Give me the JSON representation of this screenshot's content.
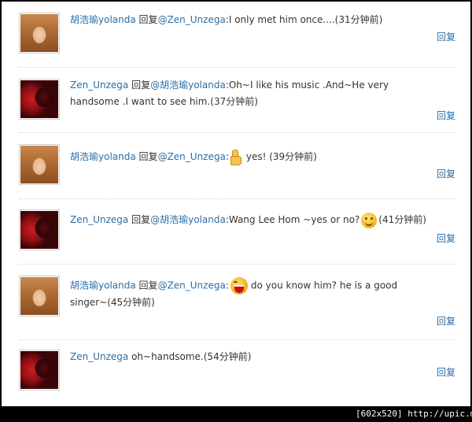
{
  "reply_label": "回复",
  "reply_verb": "回复",
  "footer_text": "[602x520] http://upic.me/",
  "colors": {
    "link": "#2a6ea6",
    "text": "#333333",
    "separator": "#cfd8e3"
  },
  "comments": [
    {
      "user": "胡浩瑜yolanda",
      "mention": "@Zen_Unzega",
      "text": "I only met him once....",
      "time": "(31分钟前)",
      "avatar": "yolanda-avatar"
    },
    {
      "user": "Zen_Unzega",
      "mention": "@胡浩瑜yolanda",
      "text": "Oh~I like his music .And~He very handsome .I want to see him.",
      "time": "(37分钟前)",
      "avatar": "zen-avatar"
    },
    {
      "user": "胡浩瑜yolanda",
      "mention": "@Zen_Unzega",
      "text": "yes!",
      "time": "(39分钟前)",
      "emoticon": "thumbs-up-icon",
      "avatar": "yolanda-avatar"
    },
    {
      "user": "Zen_Unzega",
      "mention": "@胡浩瑜yolanda",
      "text": "Wang Lee Hom ~yes or no?",
      "time": "(41分钟前)",
      "emoticon": "smile-icon",
      "avatar": "zen-avatar"
    },
    {
      "user": "胡浩瑜yolanda",
      "mention": "@Zen_Unzega",
      "text": "do you know him? he is a good singer~",
      "time": "(45分钟前)",
      "emoticon": "laugh-icon",
      "avatar": "yolanda-avatar"
    },
    {
      "user": "Zen_Unzega",
      "text": "oh~handsome.",
      "time": "(54分钟前)",
      "avatar": "zen-avatar"
    }
  ]
}
